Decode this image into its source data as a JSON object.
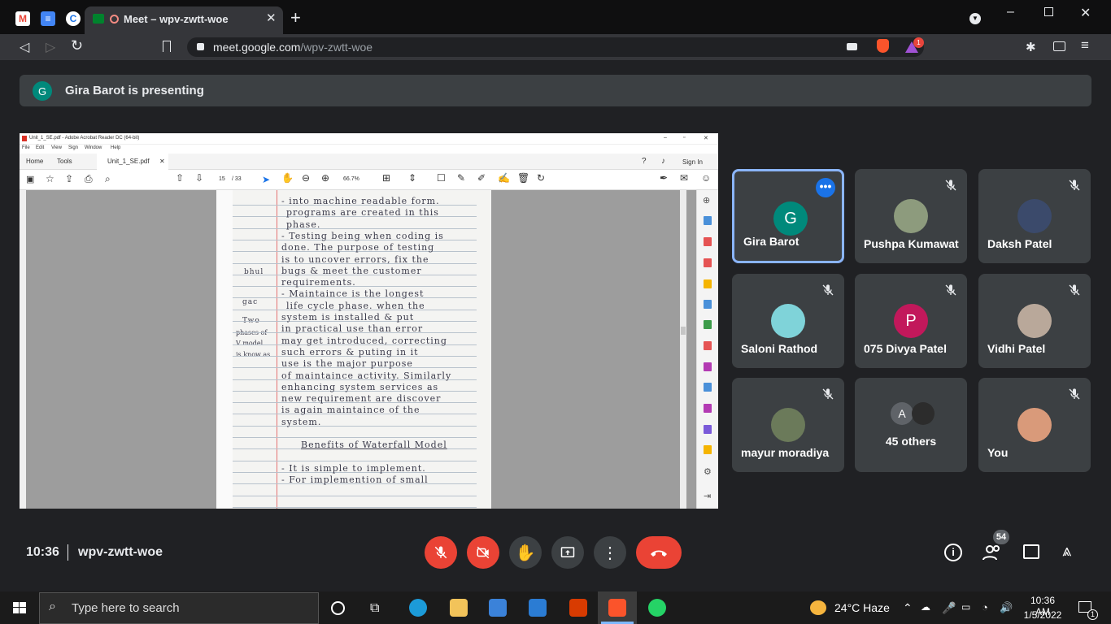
{
  "browser": {
    "tab_title": "Meet – wpv-zwtt-woe",
    "url_host": "meet.google.com",
    "url_path": "/wpv-zwtt-woe",
    "notification_count": "1"
  },
  "banner": {
    "avatar_letter": "G",
    "text": "Gira Barot is presenting"
  },
  "acrobat": {
    "window_title": "Unit_1_SE.pdf - Adobe Acrobat Reader DC (64-bit)",
    "menu": [
      "File",
      "Edit",
      "View",
      "Sign",
      "Window",
      "Help"
    ],
    "tabs": [
      "Home",
      "Tools",
      "Unit_1_SE.pdf"
    ],
    "sign_in": "Sign In",
    "page_current": "15",
    "page_total": "/ 33",
    "zoom": "66.7%"
  },
  "notes": {
    "margin": [
      "bhul",
      "gac",
      "Two",
      "phases of",
      "V model",
      "is know as"
    ],
    "lines": [
      "- into machine readable form.",
      "programs are created in this",
      "phase.",
      "- Testing being when coding is",
      "done. The purpose of testing",
      "is to uncover errors, fix the",
      "bugs & meet the customer",
      "requirements.",
      "- Maintaince is the longest",
      "life cycle phase. when the",
      "system is installed & put",
      "in practical use than error",
      "may get introduced, correcting",
      "such errors & puting in it",
      "use is the major purpose",
      "of maintaince activity. Similarly",
      "enhancing system services as",
      "new requirement are discover",
      "is again maintaince of the",
      "system.",
      "Benefits of Waterfall Model",
      "- It is simple to implement.",
      "- For implemention of small"
    ]
  },
  "participants": [
    {
      "name": "Gira Barot",
      "initial": "G",
      "color": "#00897b",
      "type": "letter",
      "mic_off": false,
      "active": true
    },
    {
      "name": "Pushpa Kumawat",
      "initial": "",
      "color": "#8d9b7d",
      "type": "photo",
      "mic_off": true,
      "active": false
    },
    {
      "name": "Daksh Patel",
      "initial": "",
      "color": "#3b4a6b",
      "type": "photo",
      "mic_off": true,
      "active": false
    },
    {
      "name": "Saloni Rathod",
      "initial": "",
      "color": "#7fd3d9",
      "type": "photo",
      "mic_off": true,
      "active": false
    },
    {
      "name": "075 Divya Patel",
      "initial": "P",
      "color": "#c2185b",
      "type": "letter",
      "mic_off": true,
      "active": false
    },
    {
      "name": "Vidhi Patel",
      "initial": "",
      "color": "#b9a89a",
      "type": "photo",
      "mic_off": true,
      "active": false
    },
    {
      "name": "mayur moradiya",
      "initial": "",
      "color": "#6b7a5a",
      "type": "photo",
      "mic_off": true,
      "active": false
    },
    {
      "name": "45 others",
      "initial": "A",
      "color": "#5f6368",
      "type": "others",
      "mic_off": false,
      "active": false
    },
    {
      "name": "You",
      "initial": "",
      "color": "#d99a7a",
      "type": "photo",
      "mic_off": true,
      "active": false
    }
  ],
  "meeting": {
    "time": "10:36",
    "code": "wpv-zwtt-woe",
    "people_count": "54"
  },
  "taskbar": {
    "search_placeholder": "Type here to search",
    "weather": "24°C  Haze",
    "clock_time": "10:36 AM",
    "clock_date": "1/5/2022",
    "notif_count": "1"
  }
}
